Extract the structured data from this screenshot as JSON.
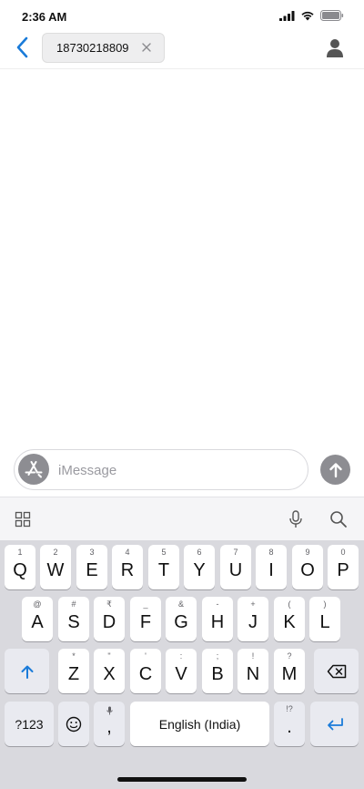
{
  "status_bar": {
    "time": "2:36 AM"
  },
  "header": {
    "recipient": "18730218809"
  },
  "compose": {
    "placeholder": "iMessage"
  },
  "keyboard": {
    "row1": [
      {
        "main": "Q",
        "sub": "1"
      },
      {
        "main": "W",
        "sub": "2"
      },
      {
        "main": "E",
        "sub": "3"
      },
      {
        "main": "R",
        "sub": "4"
      },
      {
        "main": "T",
        "sub": "5"
      },
      {
        "main": "Y",
        "sub": "6"
      },
      {
        "main": "U",
        "sub": "7"
      },
      {
        "main": "I",
        "sub": "8"
      },
      {
        "main": "O",
        "sub": "9"
      },
      {
        "main": "P",
        "sub": "0"
      }
    ],
    "row2": [
      {
        "main": "A",
        "sub": "@"
      },
      {
        "main": "S",
        "sub": "#"
      },
      {
        "main": "D",
        "sub": "₹"
      },
      {
        "main": "F",
        "sub": "_"
      },
      {
        "main": "G",
        "sub": "&"
      },
      {
        "main": "H",
        "sub": "-"
      },
      {
        "main": "J",
        "sub": "+"
      },
      {
        "main": "K",
        "sub": "("
      },
      {
        "main": "L",
        "sub": ")"
      }
    ],
    "row3": [
      {
        "main": "Z",
        "sub": "*"
      },
      {
        "main": "X",
        "sub": "\""
      },
      {
        "main": "C",
        "sub": "'"
      },
      {
        "main": "V",
        "sub": ":"
      },
      {
        "main": "B",
        "sub": ";"
      },
      {
        "main": "N",
        "sub": "!"
      },
      {
        "main": "M",
        "sub": "?"
      }
    ],
    "numbers_label": "?123",
    "comma": ",",
    "space_label": "English (India)",
    "period": ".",
    "period_sub": "!?"
  }
}
